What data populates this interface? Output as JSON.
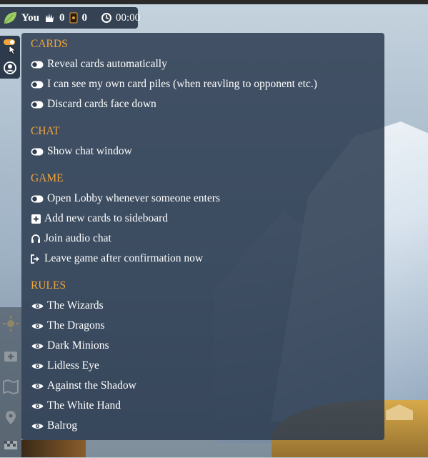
{
  "topbar": {
    "player_name": "You",
    "hand_count": "0",
    "card_count": "0",
    "timer": "00:00"
  },
  "sections": {
    "cards": {
      "title": "CARDS",
      "items": [
        {
          "label": "Reveal cards automatically",
          "icon": "toggle-off-icon"
        },
        {
          "label": "I can see my own card piles (when reavling to opponent etc.)",
          "icon": "toggle-off-icon"
        },
        {
          "label": "Discard cards face down",
          "icon": "toggle-off-icon"
        }
      ]
    },
    "chat": {
      "title": "CHAT",
      "items": [
        {
          "label": "Show chat window",
          "icon": "toggle-off-icon"
        }
      ]
    },
    "game": {
      "title": "GAME",
      "items": [
        {
          "label": "Open Lobby whenever someone enters",
          "icon": "toggle-off-icon"
        },
        {
          "label": "Add new cards to sideboard",
          "icon": "plus-square-icon"
        },
        {
          "label": "Join audio chat",
          "icon": "headphones-icon"
        },
        {
          "label": "Leave game after confirmation now",
          "icon": "sign-out-icon"
        }
      ]
    },
    "rules": {
      "title": "RULES",
      "items": [
        {
          "label": "The Wizards",
          "icon": "eye-icon"
        },
        {
          "label": "The Dragons",
          "icon": "eye-icon"
        },
        {
          "label": "Dark Minions",
          "icon": "eye-icon"
        },
        {
          "label": "Lidless Eye",
          "icon": "eye-icon"
        },
        {
          "label": "Against the Shadow",
          "icon": "eye-icon"
        },
        {
          "label": "The White Hand",
          "icon": "eye-icon"
        },
        {
          "label": "Balrog",
          "icon": "eye-icon"
        }
      ]
    }
  },
  "colors": {
    "accent": "#f0a53a",
    "panel": "#2c3b50",
    "topbar": "#344253",
    "leaf": "#9ccc65"
  }
}
